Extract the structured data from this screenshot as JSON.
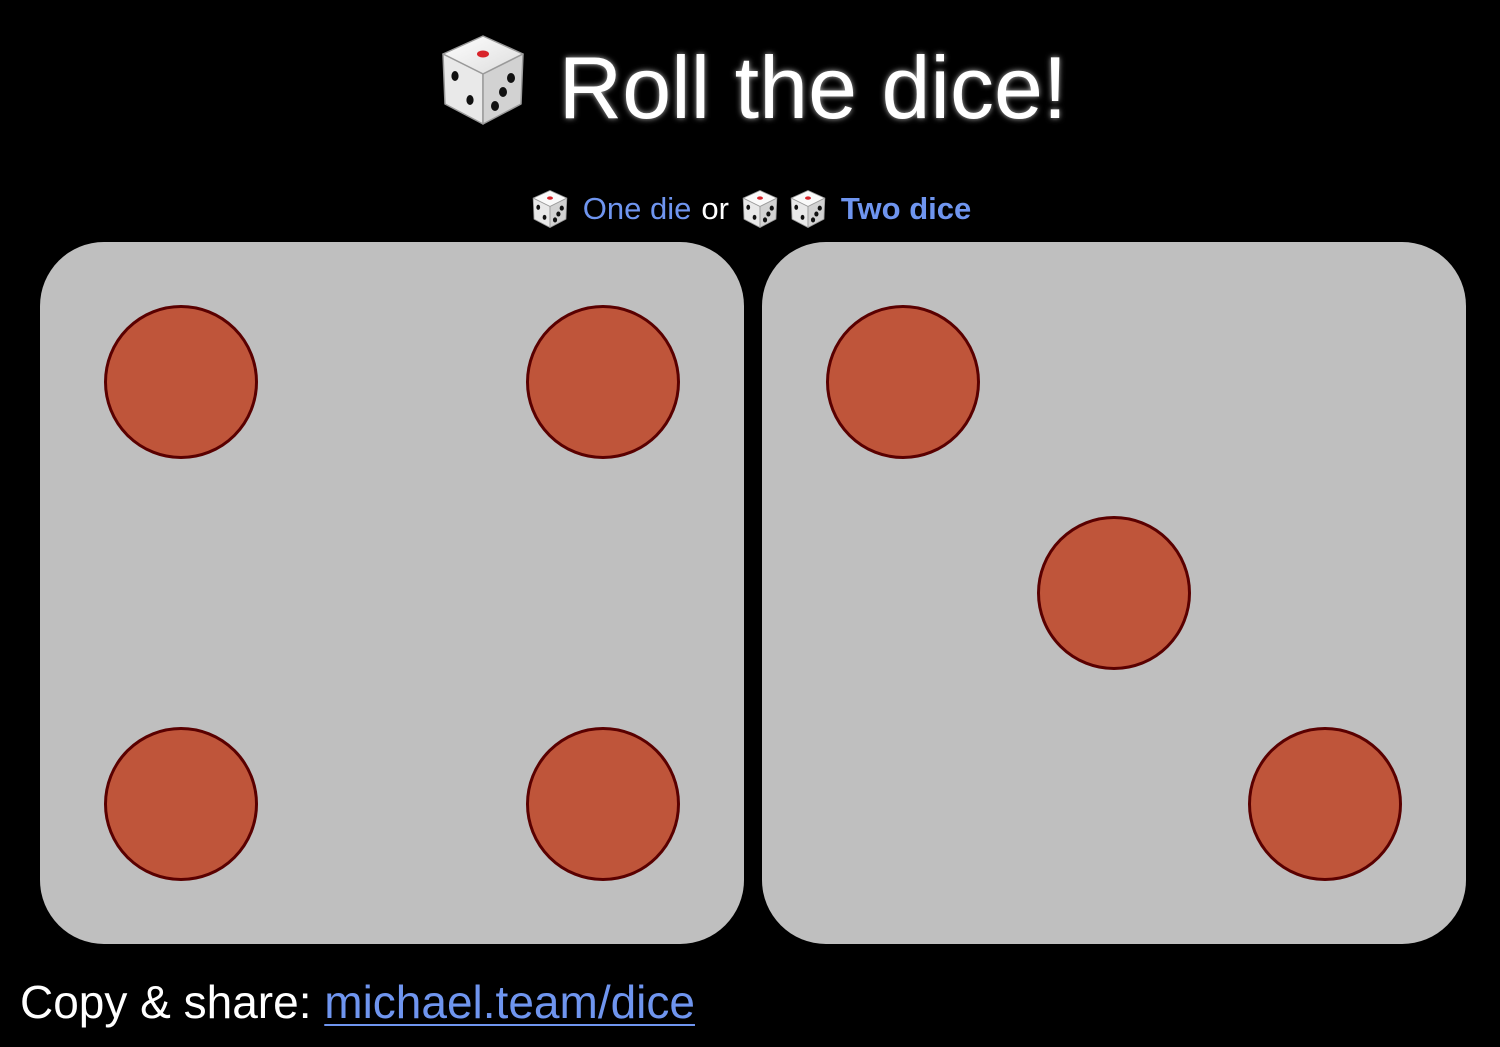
{
  "header": {
    "title": "Roll the dice!"
  },
  "mode_selector": {
    "one_die_label": "One die",
    "separator": "or",
    "two_dice_label": "Two dice",
    "active_mode": "two_dice"
  },
  "dice": [
    {
      "value": 4,
      "face_color": "#bfbfbf",
      "pip_color": "#bf553a"
    },
    {
      "value": 3,
      "face_color": "#bfbfbf",
      "pip_color": "#bf553a"
    }
  ],
  "footer": {
    "share_label": "Copy & share:",
    "share_link": "michael.team/dice"
  },
  "colors": {
    "background": "#000000",
    "link": "#6f95ef",
    "die_face": "#bfbfbf",
    "pip": "#bf553a",
    "pip_border": "#5a0000"
  }
}
